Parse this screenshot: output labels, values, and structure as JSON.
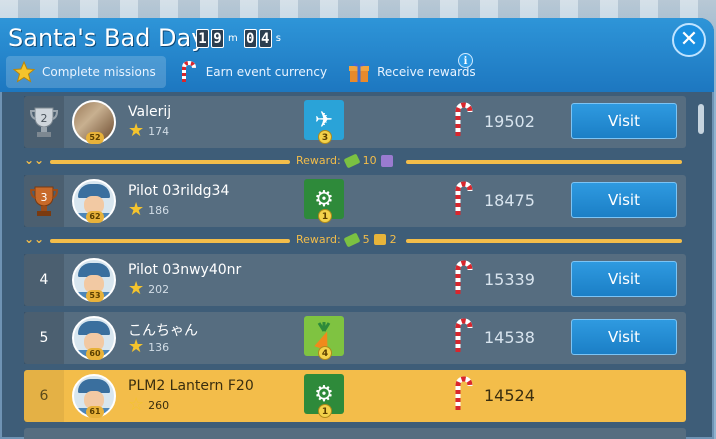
{
  "header": {
    "title": "Santa's Bad Day",
    "timer": {
      "m1": "1",
      "m2": "9",
      "m_unit": "m",
      "s1": "0",
      "s2": "4",
      "s_unit": "s"
    }
  },
  "tabs": [
    {
      "label": "Complete missions",
      "icon": "star-icon"
    },
    {
      "label": "Earn event currency",
      "icon": "candy-cane-icon"
    },
    {
      "label": "Receive rewards",
      "icon": "gift-icon"
    }
  ],
  "info_label": "i",
  "close_label": "✕",
  "rows": [
    {
      "rank": "",
      "trophy": "silver",
      "trophy_num": "2",
      "name": "Valerij",
      "level": "52",
      "stars": "174",
      "mission": "plane",
      "mission_level": "3",
      "score": "19502",
      "visit": "Visit"
    },
    {
      "rank": "",
      "trophy": "bronze",
      "trophy_num": "3",
      "name": "Pilot 03rildg34",
      "level": "62",
      "stars": "186",
      "mission": "gear",
      "mission_level": "1",
      "score": "18475",
      "visit": "Visit"
    },
    {
      "rank": "4",
      "name": "Pilot 03nwy40nr",
      "level": "53",
      "stars": "202",
      "mission": "",
      "mission_level": "",
      "score": "15339",
      "visit": "Visit"
    },
    {
      "rank": "5",
      "name": "こんちゃん",
      "level": "60",
      "stars": "136",
      "mission": "carrot",
      "mission_level": "4",
      "score": "14538",
      "visit": "Visit"
    },
    {
      "rank": "6",
      "name": "PLM2 Lantern F20",
      "level": "61",
      "stars": "260",
      "mission": "gear",
      "mission_level": "1",
      "score": "14524",
      "visit": ""
    }
  ],
  "rewards": [
    {
      "label": "Reward:",
      "amount1": "10",
      "amount2": ""
    },
    {
      "label": "Reward:",
      "amount1": "5",
      "amount2": "2"
    }
  ],
  "colors": {
    "header_blue": "#1d77c0",
    "row": "#566d80",
    "highlight": "#f3bd4a",
    "visit_button": "#1b7fc6"
  }
}
